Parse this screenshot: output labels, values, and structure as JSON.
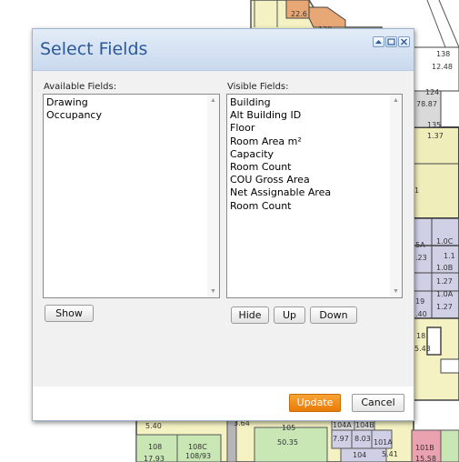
{
  "dialog": {
    "title": "Select Fields",
    "available": {
      "label": "Available Fields:",
      "items": [
        "Drawing",
        "Occupancy"
      ],
      "show_label": "Show"
    },
    "visible": {
      "label": "Visible Fields:",
      "items": [
        "Building",
        "Alt Building ID",
        "Floor",
        "Room Area m²",
        "Capacity",
        "Room Count",
        "COU Gross Area",
        "Net Assignable Area",
        "Room Count"
      ],
      "hide_label": "Hide",
      "up_label": "Up",
      "down_label": "Down"
    },
    "update_label": "Update",
    "cancel_label": "Cancel"
  },
  "floorplan": {
    "labels": [
      "22.6",
      "130",
      "138",
      "12.48",
      "124",
      "78.87",
      "135",
      "1.37",
      "1",
      "5A",
      "1.0C",
      ".23",
      "1.1",
      "1.0B",
      "1.27",
      "1.0A",
      "19",
      "1.27",
      ".40",
      "18",
      "5.43",
      "104A",
      "104B",
      "7.97",
      "8.03",
      "101A",
      "101B",
      "104",
      "5.41",
      "15.58",
      "108",
      "108C",
      "108/93",
      "17.93",
      "50.35",
      "105",
      "5.40",
      "3.64"
    ]
  }
}
